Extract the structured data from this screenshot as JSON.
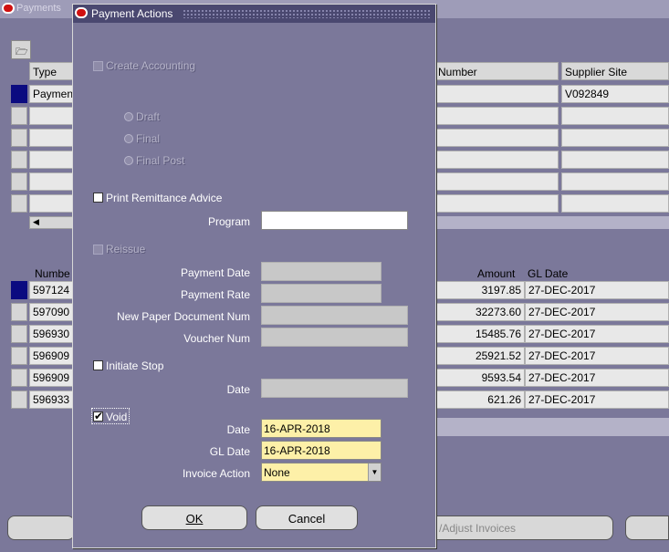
{
  "background": {
    "title": "Payments",
    "header": {
      "type": "Type",
      "number": "Number",
      "supplier_site": "Supplier Site"
    },
    "top_row": {
      "type": "Paymen",
      "supplier_site": "V092849"
    },
    "lower_header": {
      "number": "Numbe",
      "amount": "Amount",
      "gl_date": "GL Date"
    },
    "rows": [
      {
        "number": "597124",
        "amount": "3197.85",
        "gl_date": "27-DEC-2017"
      },
      {
        "number": "597090",
        "amount": "32273.60",
        "gl_date": "27-DEC-2017"
      },
      {
        "number": "596930",
        "amount": "15485.76",
        "gl_date": "27-DEC-2017"
      },
      {
        "number": "596909",
        "amount": "25921.52",
        "gl_date": "27-DEC-2017"
      },
      {
        "number": "596909",
        "amount": "9593.54",
        "gl_date": "27-DEC-2017"
      },
      {
        "number": "596933",
        "amount": "621.26",
        "gl_date": "27-DEC-2017"
      }
    ],
    "bottom_button": "/Adjust Invoices"
  },
  "dialog": {
    "title": "Payment Actions",
    "create_accounting": "Create Accounting",
    "radios": {
      "draft": "Draft",
      "final": "Final",
      "final_post": "Final Post"
    },
    "print_remittance": "Print Remittance Advice",
    "program_label": "Program",
    "program_value": "",
    "reissue": "Reissue",
    "payment_date_label": "Payment Date",
    "payment_rate_label": "Payment Rate",
    "new_paper_doc_label": "New Paper Document Num",
    "voucher_num_label": "Voucher Num",
    "initiate_stop": "Initiate Stop",
    "stop_date_label": "Date",
    "void": "Void",
    "void_date_label": "Date",
    "void_date": "16-APR-2018",
    "gl_date_label": "GL Date",
    "gl_date": "16-APR-2018",
    "invoice_action_label": "Invoice Action",
    "invoice_action": "None",
    "ok": "OK",
    "cancel": "Cancel"
  }
}
